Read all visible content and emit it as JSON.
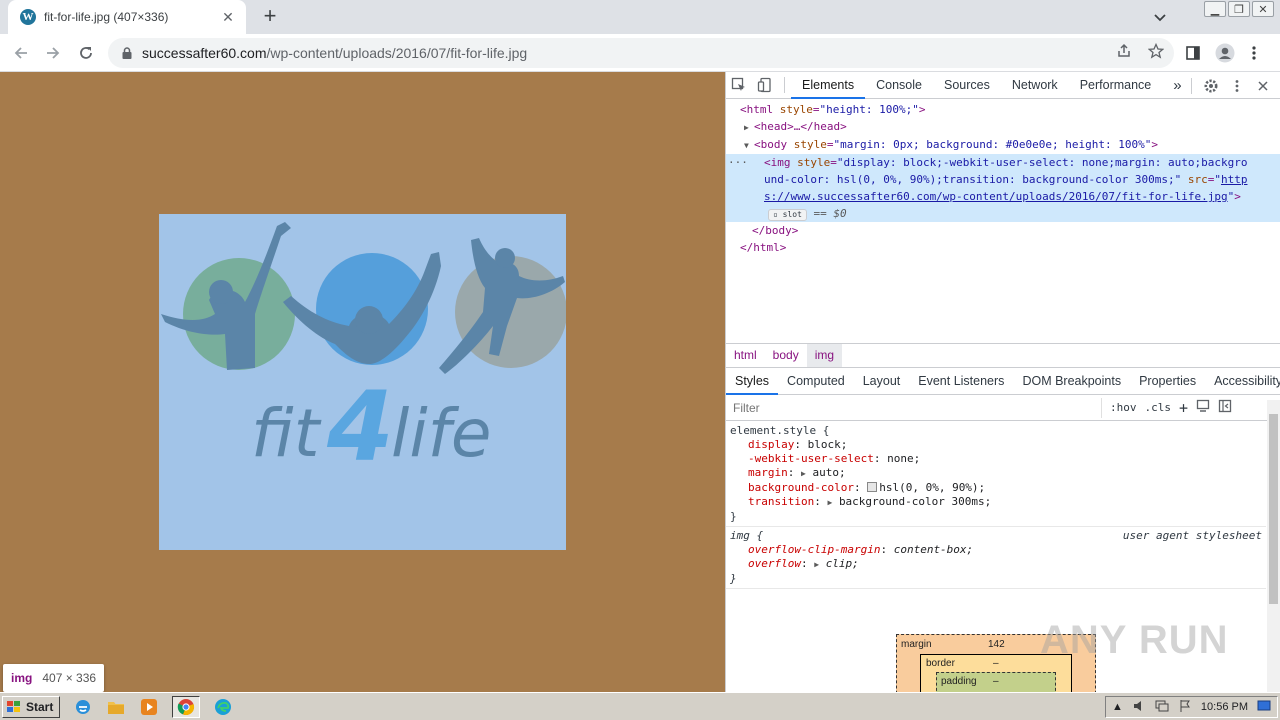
{
  "browser": {
    "tab": {
      "favicon": "wordpress-icon",
      "title": "fit-for-life.jpg (407×336)",
      "close_glyph": "✕"
    },
    "newtab_glyph": "+",
    "window_controls": [
      "minimize-icon",
      "restore-icon",
      "close-icon"
    ],
    "url": {
      "host": "successafter60.com",
      "path": "/wp-content/uploads/2016/07/fit-for-life.jpg"
    }
  },
  "viewport": {
    "background": "#a67b4b",
    "image": {
      "background": "#a2c4e8",
      "logo_text_left": "fit",
      "logo_text_mid": "4",
      "logo_text_right": "life"
    },
    "tooltip": {
      "tag": "img",
      "size": "407 × 336"
    }
  },
  "devtools": {
    "tabs": [
      "Elements",
      "Console",
      "Sources",
      "Network",
      "Performance"
    ],
    "active_tab": "Elements",
    "more_tabs_glyph": "»",
    "dom": {
      "html_open": "<html",
      "html_attr_name": "style",
      "html_attr_value": "\"height: 100%;\"",
      "head": "<head>…</head>",
      "body_attr_name": "style",
      "body_attr_value": "\"margin: 0px; background: #0e0e0e; height: 100%\"",
      "img_attr_name": "style",
      "img_style_1": "\"display: block;-webkit-user-select: none;margin: auto;backgro",
      "img_style_2": "und-color: hsl(0, 0%, 90%);transition: background-color 300ms;\"",
      "img_src_name": "src",
      "img_src_1": "\"http",
      "img_src_link_1": "http",
      "img_src_link_2": "s://www.successafter60.com/wp-content/uploads/2016/07/fit-for-life.jpg",
      "slot_label": "slot",
      "eq_sel": "== $0",
      "body_close": "</body>",
      "html_close": "</html>"
    },
    "breadcrumbs": [
      "html",
      "body",
      "img"
    ],
    "subtabs": [
      "Styles",
      "Computed",
      "Layout",
      "Event Listeners",
      "DOM Breakpoints",
      "Properties",
      "Accessibility"
    ],
    "filter_placeholder": "Filter",
    "filter_tools": {
      "hov": ":hov",
      "cls": ".cls",
      "plus": "+"
    },
    "element_style": {
      "selector": "element.style {",
      "props": [
        {
          "name": "display",
          "value": "block;"
        },
        {
          "name": "-webkit-user-select",
          "value": "none;"
        },
        {
          "name": "margin",
          "value": "auto;"
        },
        {
          "name": "background-color",
          "value": "hsl(0, 0%, 90%);"
        },
        {
          "name": "transition",
          "value": "background-color 300ms;"
        }
      ],
      "close": "}"
    },
    "ua_rule": {
      "selector": "img {",
      "source": "user agent stylesheet",
      "props": [
        {
          "name": "overflow-clip-margin",
          "value": "content-box;"
        },
        {
          "name": "overflow",
          "value": "clip;"
        }
      ],
      "close": "}"
    },
    "box_model": {
      "margin_label": "margin",
      "margin_top": "142",
      "border_label": "border",
      "border_value": "–",
      "padding_label": "padding",
      "padding_value": "–"
    }
  },
  "watermark": "ANY RUN",
  "taskbar": {
    "start_label": "Start",
    "clock": "10:56 PM"
  }
}
